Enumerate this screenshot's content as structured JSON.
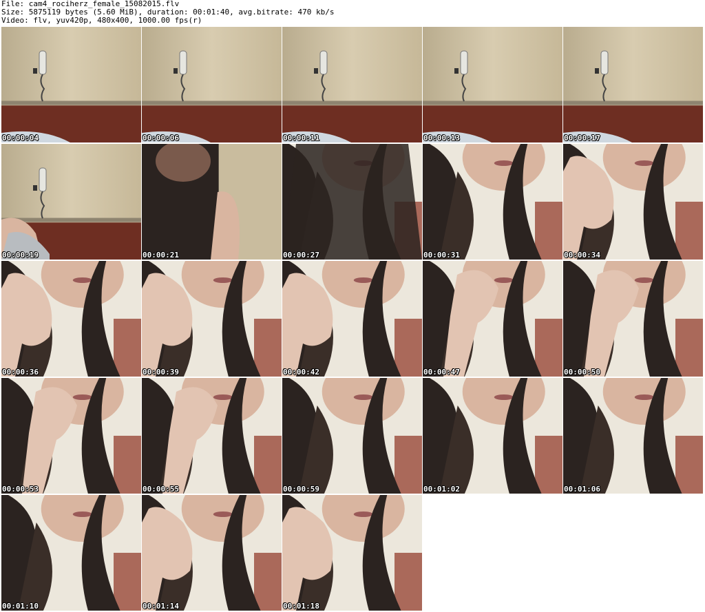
{
  "header": {
    "file": "File: cam4_rociherz_female_15082015.flv",
    "size": "Size: 5875119 bytes (5.60 MiB), duration: 00:01:40, avg.bitrate: 470 kb/s",
    "video": "Video: flv, yuv420p, 480x400, 1000.00 fps(r)"
  },
  "thumbnails": [
    {
      "timestamp": "00:00:04",
      "scene": "room"
    },
    {
      "timestamp": "00:00:06",
      "scene": "room"
    },
    {
      "timestamp": "00:00:11",
      "scene": "room"
    },
    {
      "timestamp": "00:00:13",
      "scene": "room"
    },
    {
      "timestamp": "00:00:17",
      "scene": "room"
    },
    {
      "timestamp": "00:00:19",
      "scene": "room-arm"
    },
    {
      "timestamp": "00:00:21",
      "scene": "dark-hair"
    },
    {
      "timestamp": "00:00:27",
      "scene": "hair-closeup"
    },
    {
      "timestamp": "00:00:31",
      "scene": "face-hair"
    },
    {
      "timestamp": "00:00:34",
      "scene": "hand-chin"
    },
    {
      "timestamp": "00:00:36",
      "scene": "hand-chin"
    },
    {
      "timestamp": "00:00:39",
      "scene": "hand-chin"
    },
    {
      "timestamp": "00:00:42",
      "scene": "hand-chin"
    },
    {
      "timestamp": "00:00:47",
      "scene": "fist-face"
    },
    {
      "timestamp": "00:00:50",
      "scene": "fist-face"
    },
    {
      "timestamp": "00:00:53",
      "scene": "fist-face"
    },
    {
      "timestamp": "00:00:55",
      "scene": "fist-face"
    },
    {
      "timestamp": "00:00:59",
      "scene": "face-hair"
    },
    {
      "timestamp": "00:01:02",
      "scene": "face-hair"
    },
    {
      "timestamp": "00:01:06",
      "scene": "face-hair"
    },
    {
      "timestamp": "00:01:10",
      "scene": "face-hair"
    },
    {
      "timestamp": "00:01:14",
      "scene": "hand-cheek"
    },
    {
      "timestamp": "00:01:18",
      "scene": "hand-chin"
    }
  ],
  "colors": {
    "wall": "#c9bc9e",
    "floor": "#6e2e22",
    "hair": "#2b2320",
    "skin": "#d9b5a0",
    "background_light": "#ece7dc"
  }
}
